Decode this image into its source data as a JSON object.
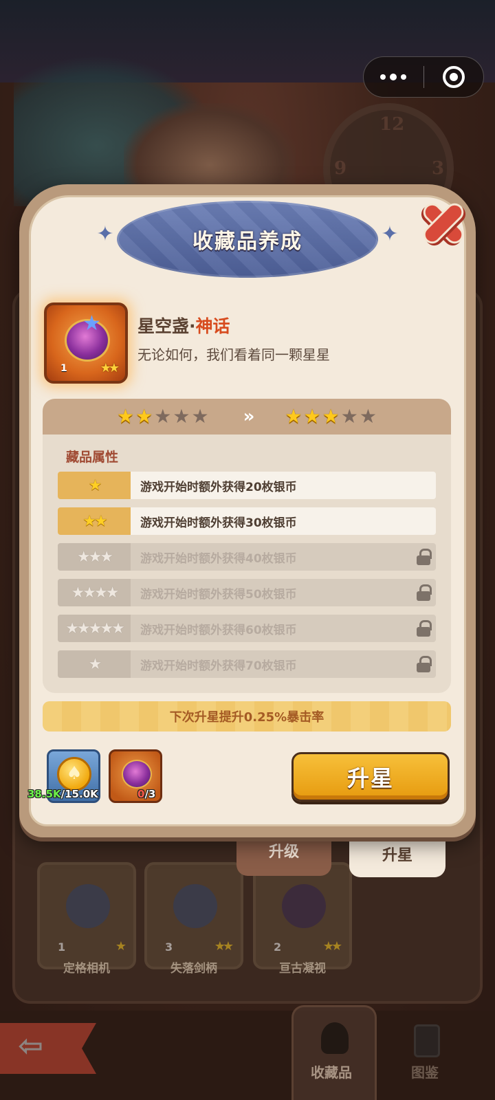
{
  "header": {
    "title": "收藏品养成"
  },
  "item": {
    "name": "星空盏",
    "separator": "·",
    "rarity": "神话",
    "description": "无论如何，我们看着同一颗星星",
    "level": "1",
    "stars": "★★"
  },
  "star_progress": {
    "current_stars": 2,
    "next_stars": 3,
    "max_stars": 5,
    "arrow": "»"
  },
  "attributes": {
    "title": "藏品属性",
    "rows": [
      {
        "stars": "★",
        "text": "游戏开始时额外获得20枚银币",
        "locked": false
      },
      {
        "stars": "★★",
        "text": "游戏开始时额外获得30枚银币",
        "locked": false
      },
      {
        "stars": "★★★",
        "text": "游戏开始时额外获得40枚银币",
        "locked": true
      },
      {
        "stars": "★★★★",
        "text": "游戏开始时额外获得50枚银币",
        "locked": true
      },
      {
        "stars": "★★★★★",
        "text": "游戏开始时额外获得60枚银币",
        "locked": true
      },
      {
        "stars": "★",
        "text": "游戏开始时额外获得70枚银币",
        "locked": true
      }
    ]
  },
  "next_bonus": "下次升星提升0.25%暴击率",
  "costs": {
    "coin_have": "38.5K",
    "coin_need": "/15.0K",
    "fragment_have": "0",
    "fragment_need": "/3"
  },
  "actions": {
    "upstar_button": "升星"
  },
  "tabs": {
    "upgrade": "升级",
    "upstar": "升星"
  },
  "collection": [
    {
      "name": "定格相机",
      "level": "1",
      "stars": "★"
    },
    {
      "name": "失落剑柄",
      "level": "3",
      "stars": "★★"
    },
    {
      "name": "亘古凝视",
      "level": "2",
      "stars": "★★"
    }
  ],
  "bottom_nav": {
    "collection": "收藏品",
    "catalog": "图鉴"
  },
  "colors": {
    "accent_orange": "#e69a0e",
    "rarity_red": "#d74b1e",
    "panel_cream": "#f4eadc",
    "banner_blue": "#5d6fa6"
  }
}
